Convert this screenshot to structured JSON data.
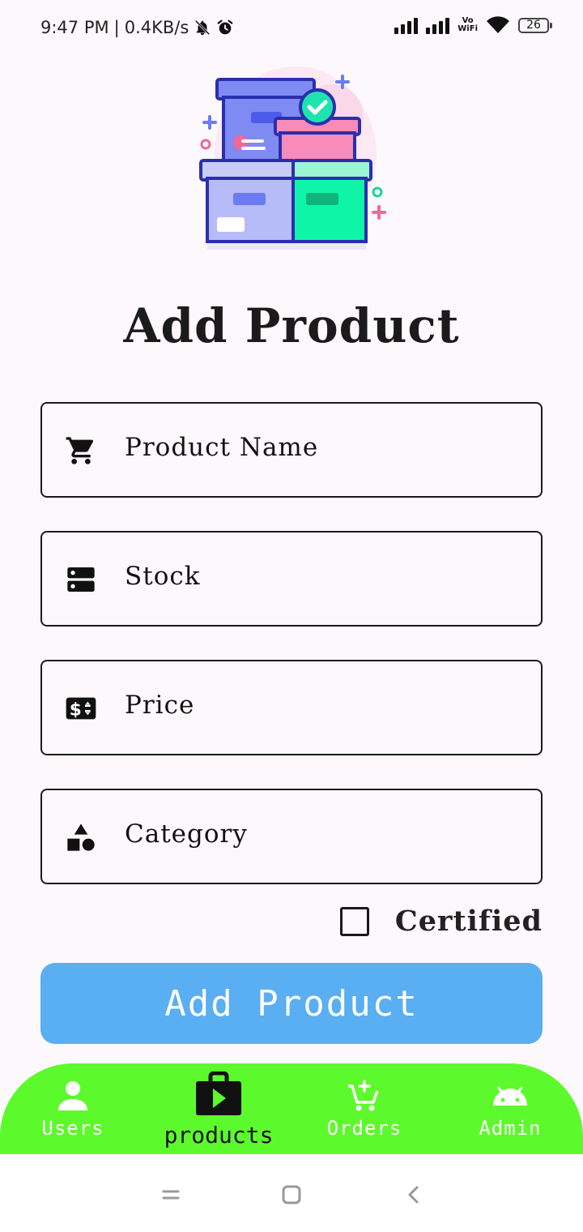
{
  "status_bar": {
    "time": "9:47 PM",
    "net_speed": "0.4KB/s",
    "vowifi_top": "Vo",
    "vowifi_bottom": "WiFi",
    "battery": "26",
    "icons": [
      "bell-off-icon",
      "alarm-icon",
      "signal-icon",
      "signal-icon",
      "wifi-icon",
      "battery-icon"
    ]
  },
  "form": {
    "title": "Add Product",
    "fields": [
      {
        "label": "Product Name",
        "icon": "cart-icon"
      },
      {
        "label": "Stock",
        "icon": "storage-icon"
      },
      {
        "label": "Price",
        "icon": "price-tag-icon"
      },
      {
        "label": "Category",
        "icon": "category-shapes-icon"
      }
    ],
    "certified_label": "Certified",
    "certified_checked": false,
    "submit_label": "Add Product"
  },
  "colors": {
    "button": "#5aaef2",
    "nav_background": "#5cfa2c",
    "page_background": "#fdf8fc"
  },
  "bottom_nav": {
    "items": [
      {
        "label": "Users",
        "icon": "person-icon"
      },
      {
        "label": "products",
        "icon": "shop-play-icon",
        "active": true
      },
      {
        "label": "Orders",
        "icon": "add-cart-icon"
      },
      {
        "label": "Admin",
        "icon": "android-icon"
      }
    ]
  }
}
